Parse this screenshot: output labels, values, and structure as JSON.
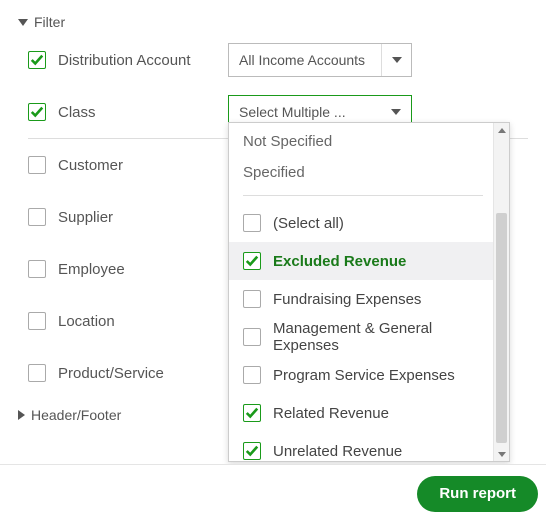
{
  "filter_section": {
    "title": "Filter",
    "rows": [
      {
        "label": "Distribution Account",
        "checked": true
      },
      {
        "label": "Class",
        "checked": true
      },
      {
        "label": "Customer",
        "checked": false
      },
      {
        "label": "Supplier",
        "checked": false
      },
      {
        "label": "Employee",
        "checked": false
      },
      {
        "label": "Location",
        "checked": false
      },
      {
        "label": "Product/Service",
        "checked": false
      }
    ],
    "distribution_select": "All Income Accounts",
    "class_select": "Select Multiple ..."
  },
  "header_footer_section": {
    "title": "Header/Footer"
  },
  "dropdown": {
    "group_not_specified": "Not Specified",
    "group_specified": "Specified",
    "items": [
      {
        "label": "(Select all)",
        "checked": false
      },
      {
        "label": "Excluded Revenue",
        "checked": true,
        "highlight": true
      },
      {
        "label": "Fundraising Expenses",
        "checked": false
      },
      {
        "label": "Management & General Expenses",
        "checked": false
      },
      {
        "label": "Program Service Expenses",
        "checked": false
      },
      {
        "label": "Related Revenue",
        "checked": true
      },
      {
        "label": "Unrelated Revenue",
        "checked": true
      }
    ]
  },
  "footer": {
    "run_label": "Run report"
  }
}
